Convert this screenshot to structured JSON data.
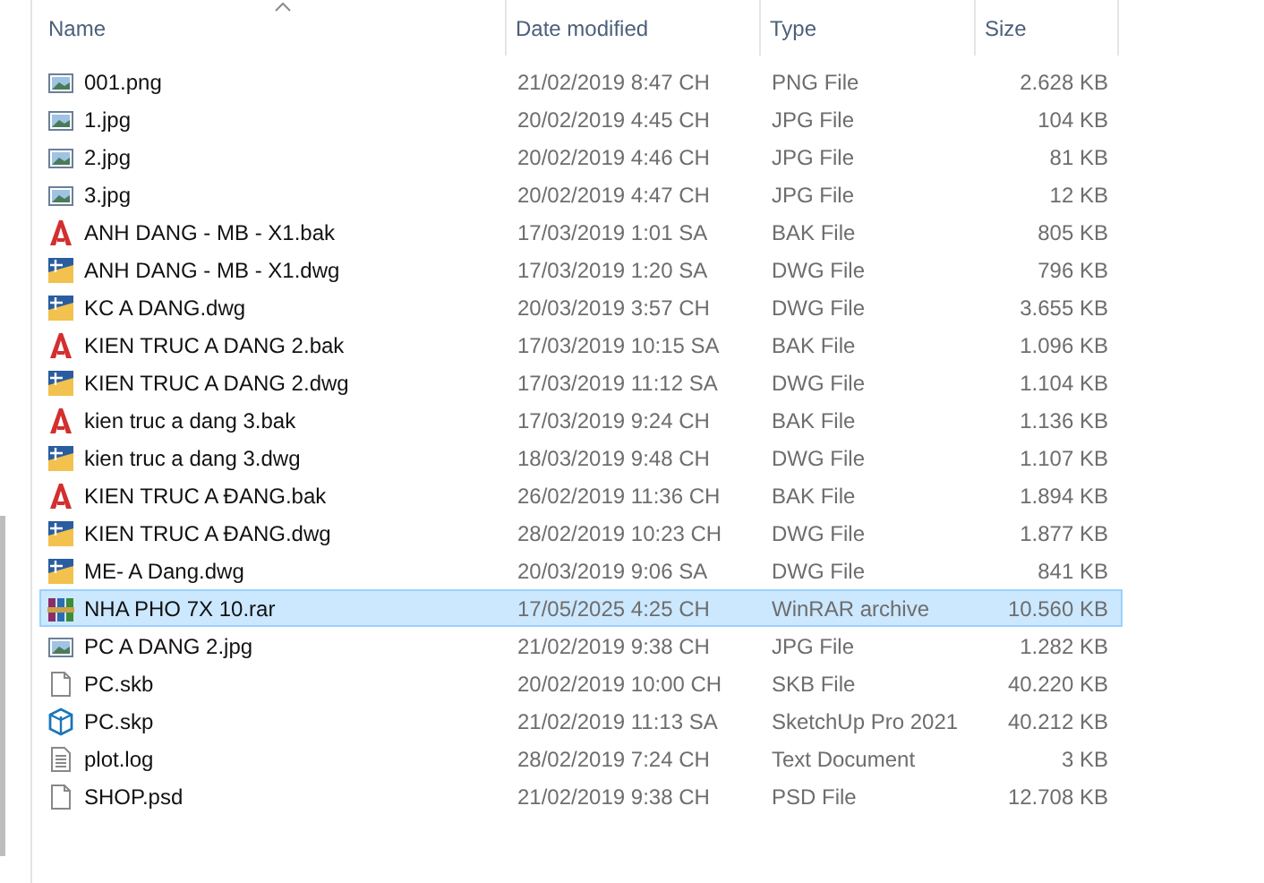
{
  "columns": [
    {
      "label": "Name",
      "sorted": true
    },
    {
      "label": "Date modified",
      "sorted": false
    },
    {
      "label": "Type",
      "sorted": false
    },
    {
      "label": "Size",
      "sorted": false
    }
  ],
  "files": [
    {
      "name": "001.png",
      "date": "21/02/2019 8:47 CH",
      "type": "PNG File",
      "size": "2.628 KB",
      "kind": "image",
      "selected": false
    },
    {
      "name": "1.jpg",
      "date": "20/02/2019 4:45 CH",
      "type": "JPG File",
      "size": "104 KB",
      "kind": "image",
      "selected": false
    },
    {
      "name": "2.jpg",
      "date": "20/02/2019 4:46 CH",
      "type": "JPG File",
      "size": "81 KB",
      "kind": "image",
      "selected": false
    },
    {
      "name": "3.jpg",
      "date": "20/02/2019 4:47 CH",
      "type": "JPG File",
      "size": "12 KB",
      "kind": "image",
      "selected": false
    },
    {
      "name": "ANH DANG - MB - X1.bak",
      "date": "17/03/2019 1:01 SA",
      "type": "BAK File",
      "size": "805 KB",
      "kind": "bak",
      "selected": false
    },
    {
      "name": "ANH DANG - MB - X1.dwg",
      "date": "17/03/2019 1:20 SA",
      "type": "DWG File",
      "size": "796 KB",
      "kind": "dwg",
      "selected": false
    },
    {
      "name": "KC A DANG.dwg",
      "date": "20/03/2019 3:57 CH",
      "type": "DWG File",
      "size": "3.655 KB",
      "kind": "dwg",
      "selected": false
    },
    {
      "name": "KIEN TRUC A DANG 2.bak",
      "date": "17/03/2019 10:15 SA",
      "type": "BAK File",
      "size": "1.096 KB",
      "kind": "bak",
      "selected": false
    },
    {
      "name": "KIEN TRUC A DANG 2.dwg",
      "date": "17/03/2019 11:12 SA",
      "type": "DWG File",
      "size": "1.104 KB",
      "kind": "dwg",
      "selected": false
    },
    {
      "name": "kien truc a dang 3.bak",
      "date": "17/03/2019 9:24 CH",
      "type": "BAK File",
      "size": "1.136 KB",
      "kind": "bak",
      "selected": false
    },
    {
      "name": "kien truc a dang 3.dwg",
      "date": "18/03/2019 9:48 CH",
      "type": "DWG File",
      "size": "1.107 KB",
      "kind": "dwg",
      "selected": false
    },
    {
      "name": "KIEN TRUC A ĐANG.bak",
      "date": "26/02/2019 11:36 CH",
      "type": "BAK File",
      "size": "1.894 KB",
      "kind": "bak",
      "selected": false
    },
    {
      "name": "KIEN TRUC A ĐANG.dwg",
      "date": "28/02/2019 10:23 CH",
      "type": "DWG File",
      "size": "1.877 KB",
      "kind": "dwg",
      "selected": false
    },
    {
      "name": "ME- A Dang.dwg",
      "date": "20/03/2019 9:06 SA",
      "type": "DWG File",
      "size": "841 KB",
      "kind": "dwg",
      "selected": false
    },
    {
      "name": "NHA PHO 7X 10.rar",
      "date": "17/05/2025 4:25 CH",
      "type": "WinRAR archive",
      "size": "10.560 KB",
      "kind": "rar",
      "selected": true
    },
    {
      "name": "PC A DANG 2.jpg",
      "date": "21/02/2019 9:38 CH",
      "type": "JPG File",
      "size": "1.282 KB",
      "kind": "image",
      "selected": false
    },
    {
      "name": "PC.skb",
      "date": "20/02/2019 10:00 CH",
      "type": "SKB File",
      "size": "40.220 KB",
      "kind": "blank",
      "selected": false
    },
    {
      "name": "PC.skp",
      "date": "21/02/2019 11:13 SA",
      "type": "SketchUp Pro 2021",
      "size": "40.212 KB",
      "kind": "skp",
      "selected": false
    },
    {
      "name": "plot.log",
      "date": "28/02/2019 7:24 CH",
      "type": "Text Document",
      "size": "3 KB",
      "kind": "text",
      "selected": false
    },
    {
      "name": "SHOP.psd",
      "date": "21/02/2019 9:38 CH",
      "type": "PSD File",
      "size": "12.708 KB",
      "kind": "blank",
      "selected": false
    }
  ]
}
